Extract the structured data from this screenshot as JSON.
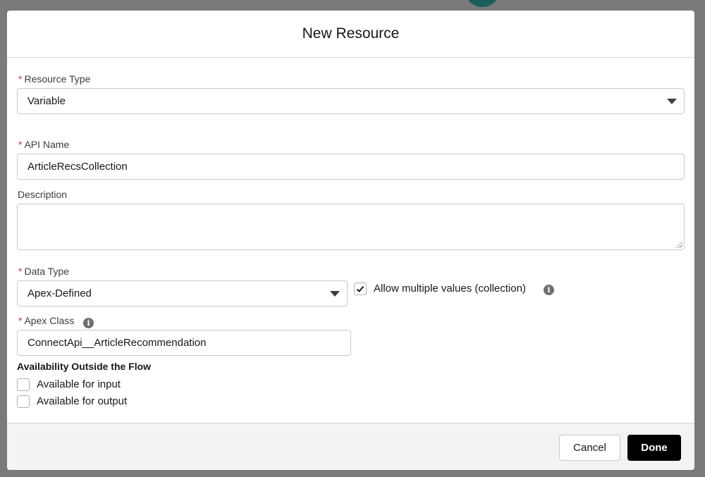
{
  "modal": {
    "title": "New Resource"
  },
  "required_marker": "*",
  "resource_type": {
    "label": "Resource Type",
    "value": "Variable"
  },
  "api_name": {
    "label": "API Name",
    "value": "ArticleRecsCollection"
  },
  "description": {
    "label": "Description",
    "value": ""
  },
  "data_type": {
    "label": "Data Type",
    "value": "Apex-Defined"
  },
  "allow_multiple": {
    "label": "Allow multiple values (collection)",
    "checked": true
  },
  "apex_class": {
    "label": "Apex Class",
    "value": "ConnectApi__ArticleRecommendation"
  },
  "availability": {
    "heading": "Availability Outside the Flow",
    "input_label": "Available for input",
    "input_checked": false,
    "output_label": "Available for output",
    "output_checked": false
  },
  "footer": {
    "cancel_label": "Cancel",
    "done_label": "Done"
  },
  "icons": {
    "info": "info-icon",
    "dropdown": "chevron-down-icon",
    "check": "checkmark-icon"
  }
}
